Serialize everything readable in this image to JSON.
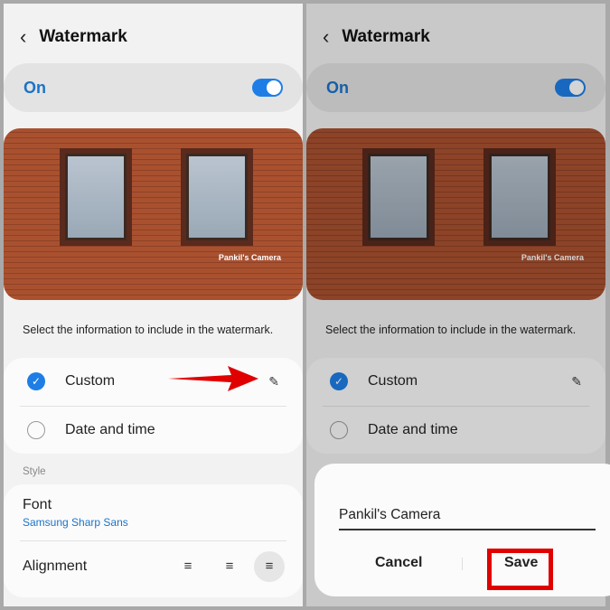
{
  "header": {
    "back_icon": "chevron-left-icon",
    "title": "Watermark"
  },
  "toggle": {
    "label": "On",
    "state": true
  },
  "preview": {
    "watermark_text": "Pankil's Camera"
  },
  "hint": "Select the information to include in the watermark.",
  "options": [
    {
      "label": "Custom",
      "checked": true,
      "icon": "pencil-icon"
    },
    {
      "label": "Date and time",
      "checked": false
    }
  ],
  "style": {
    "section_label": "Style",
    "font_label": "Font",
    "font_value": "Samsung Sharp Sans",
    "alignment_label": "Alignment",
    "alignment_options": [
      "left",
      "center",
      "right"
    ],
    "alignment_selected": "right"
  },
  "dialog": {
    "input_value": "Pankil's Camera",
    "cancel_label": "Cancel",
    "save_label": "Save"
  },
  "colors": {
    "accent": "#1e7ee6",
    "annotation": "#e00000"
  }
}
